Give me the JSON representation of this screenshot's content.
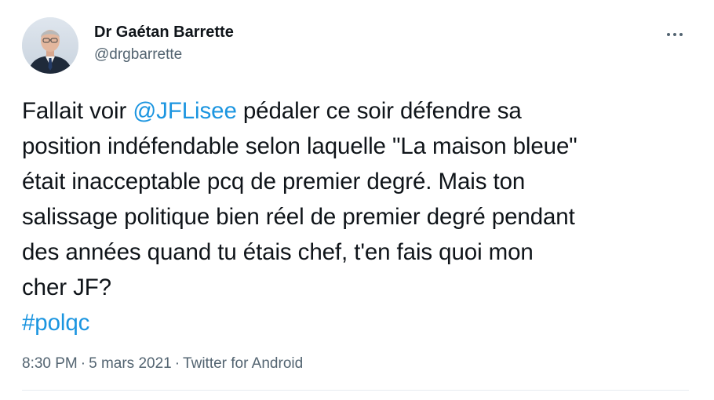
{
  "author": {
    "display_name": "Dr Gaétan Barrette",
    "handle": "@drgbarrette"
  },
  "tweet": {
    "lines": [
      [
        {
          "text": "Fallait voir ",
          "link": false
        },
        {
          "text": "@JFLisee",
          "link": true
        },
        {
          "text": " pédaler ce soir défendre sa",
          "link": false
        }
      ],
      [
        {
          "text": "position indéfendable selon laquelle \"La maison bleue\"",
          "link": false
        }
      ],
      [
        {
          "text": "était inacceptable pcq de premier degré. Mais ton",
          "link": false
        }
      ],
      [
        {
          "text": "salissage politique bien réel de premier degré pendant",
          "link": false
        }
      ],
      [
        {
          "text": "des années quand tu étais chef, t'en fais quoi mon",
          "link": false
        }
      ],
      [
        {
          "text": "cher JF?",
          "link": false
        }
      ],
      [
        {
          "text": "#polqc",
          "link": true
        }
      ]
    ]
  },
  "meta": {
    "time": "8:30 PM",
    "separator": "·",
    "date": "5 mars 2021",
    "source": "Twitter for Android"
  },
  "colors": {
    "link": "#1b95e0",
    "text": "#0f1419",
    "secondary": "#536471",
    "divider": "#e6ecf0"
  },
  "icons": {
    "more": "more-horizontal-icon"
  }
}
